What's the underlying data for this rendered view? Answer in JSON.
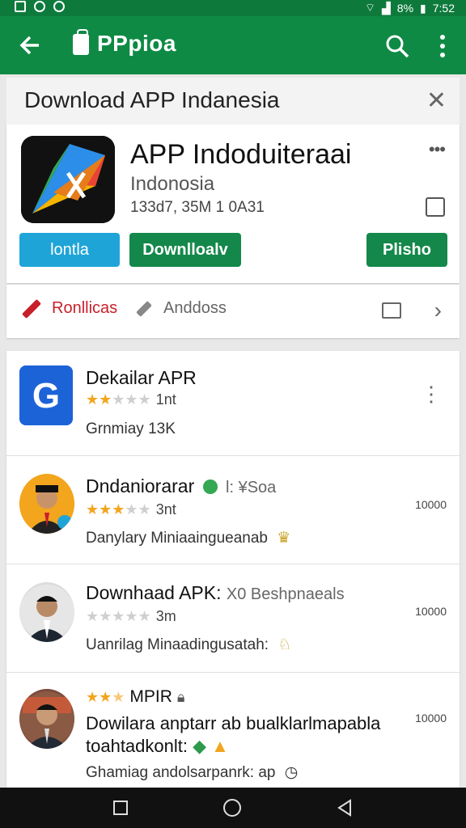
{
  "status_bar": {
    "battery_text": "8%",
    "time": "7:52"
  },
  "toolbar": {
    "title": "PPpioa"
  },
  "banner": {
    "text": "Download APP Indanesia",
    "close_glyph": "✕"
  },
  "app": {
    "name": "APP Indoduiteraai",
    "country": "Indonosia",
    "meta": "133d7, 35M 1 0A31",
    "more_glyph": "•••",
    "buttons": [
      "lontla",
      "Downlloalv",
      "Plisho"
    ]
  },
  "tabs": {
    "primary_label": "Ronllicas",
    "secondary_label": "Anddoss"
  },
  "list": [
    {
      "title": "Dekailar APR",
      "rating_text": "1nt",
      "sub": "Grnmiay 13K",
      "stars": 2
    },
    {
      "title": "Dndaniorarar",
      "title_extra": "l: ¥Soa",
      "rating_text": "3nt",
      "sub": "Danylary Miniaaingueanab",
      "count": "10000",
      "stars": 3
    },
    {
      "title": "Downhaad APK:",
      "title_extra": "X0 Beshpnaeals",
      "rating_text": "3m",
      "sub": "Uanrilag Minaadingusatah:",
      "count": "10000",
      "stars": 0
    },
    {
      "title_extra": "MPIR",
      "lines": [
        "Dowilara anptarr ab bualklarlmapabla",
        "toahtadkonlt:"
      ],
      "sub": "Ghamiag andolsarpanrk: ap",
      "count": "10000",
      "stars": 2.5
    }
  ],
  "colors": {
    "green": "#0f8a45",
    "blue": "#1fa4d8",
    "red": "#c8202a",
    "star": "#f2a51d"
  }
}
